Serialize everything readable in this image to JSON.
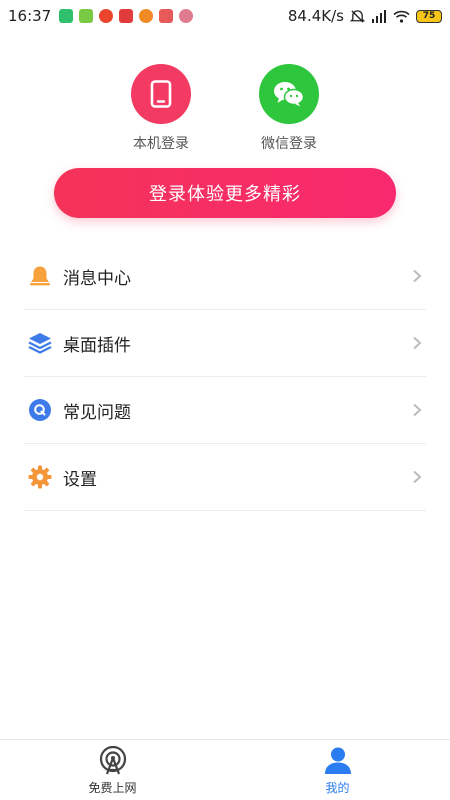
{
  "status_bar": {
    "time": "16:37",
    "net_speed": "84.4K/s",
    "battery": "75",
    "app_icon_colors": [
      "#2ec06d",
      "#7ac943",
      "#e8452c",
      "#e23b3b",
      "#f08a24",
      "#e85a5a",
      "#e07a8e"
    ]
  },
  "login": {
    "phone_label": "本机登录",
    "wechat_label": "微信登录",
    "button_label": "登录体验更多精彩"
  },
  "menu": {
    "items": [
      {
        "label": "消息中心",
        "icon": "bell-icon"
      },
      {
        "label": "桌面插件",
        "icon": "layers-icon"
      },
      {
        "label": "常见问题",
        "icon": "question-icon"
      },
      {
        "label": "设置",
        "icon": "gear-icon"
      }
    ]
  },
  "tabbar": {
    "tabs": [
      {
        "label": "免费上网",
        "icon": "wifi-tower-icon",
        "active": false
      },
      {
        "label": "我的",
        "icon": "user-icon",
        "active": true
      }
    ]
  },
  "colors": {
    "accent_pink": "#f53358",
    "wechat_green": "#2dc63d",
    "active_blue": "#2b7cf0",
    "bell_orange": "#f7a23b",
    "layers_blue": "#3d7bea",
    "gear_orange": "#f5963a"
  }
}
